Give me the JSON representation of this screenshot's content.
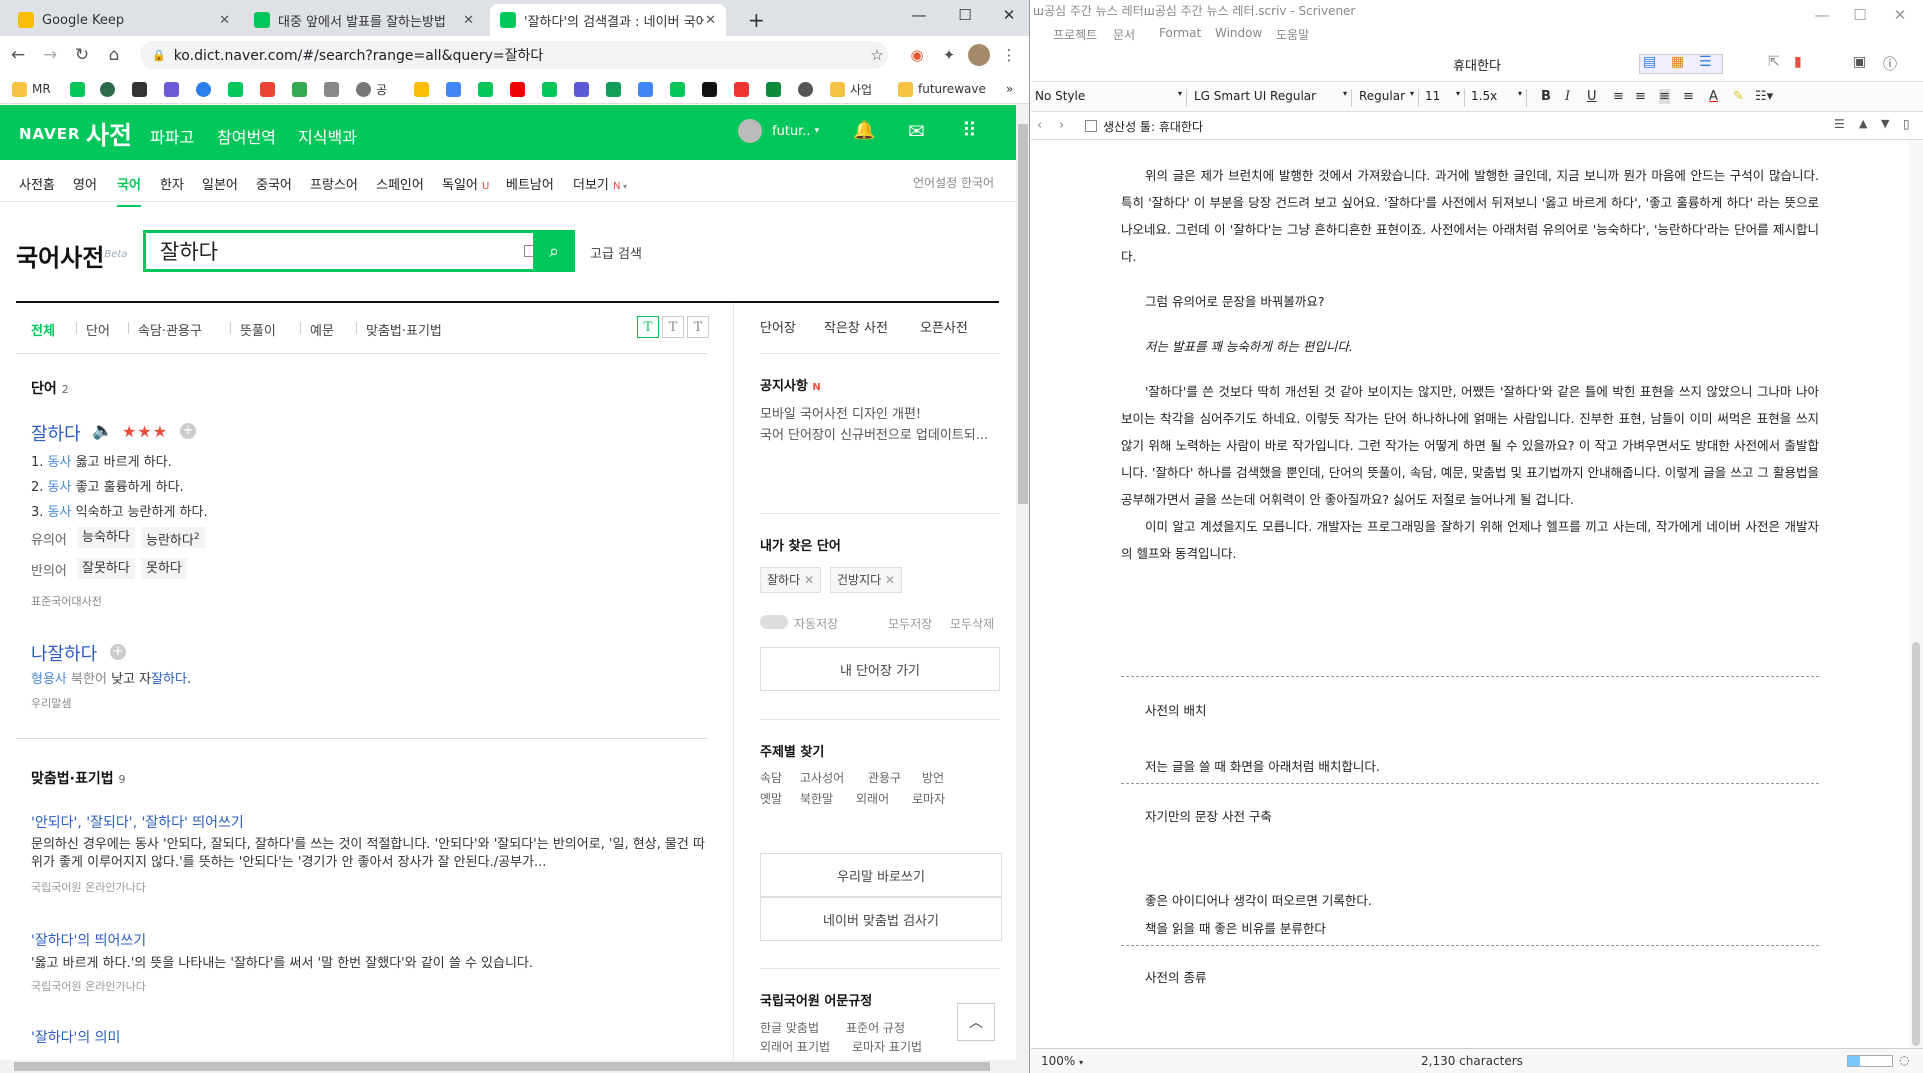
{
  "browser": {
    "tabs": [
      {
        "title": "Google Keep",
        "icon": "keep-icon",
        "color": "#fbbc04"
      },
      {
        "title": "대중 앞에서 발표를 잘하는방법",
        "icon": "blog-icon",
        "color": "#03c75a"
      },
      {
        "title": "'잘하다'의 검색결과 : 네이버 국어",
        "icon": "naver-dict-icon",
        "color": "#03c75a"
      }
    ],
    "new_tab": "+",
    "url": "ko.dict.naver.com/#/search?range=all&query=잘하다",
    "bookmarks": [
      "MR",
      "공",
      "사업",
      "futurewave"
    ],
    "more_bookmarks": "»"
  },
  "naver": {
    "logo": "NAVER",
    "service": "사전",
    "nav_links": [
      "파파고",
      "참여번역",
      "지식백과"
    ],
    "user": "futur..",
    "lang_nav": [
      "사전홈",
      "영어",
      "국어",
      "한자",
      "일본어",
      "중국어",
      "프랑스어",
      "스페인어",
      "독일어",
      "베트남어",
      "더보기"
    ],
    "lang_nav_badges": {
      "u": "U",
      "n": "N"
    },
    "lang_setting": "언어설정 한국어",
    "dict_title": "국어사전",
    "beta": "Beta",
    "query": "잘하다",
    "advanced_search": "고급 검색",
    "filter_tabs": [
      "전체",
      "단어",
      "속담·관용구",
      "뜻풀이",
      "예문",
      "맞춤법·표기법"
    ],
    "text_size": [
      "T",
      "T",
      "T"
    ],
    "word_section": {
      "title": "단어",
      "count": "2"
    },
    "entry1": {
      "word": "잘하다",
      "stars": "★★★",
      "meanings": [
        {
          "num": "1.",
          "pos": "동사",
          "text": "옳고 바르게 하다."
        },
        {
          "num": "2.",
          "pos": "동사",
          "text": "좋고 훌륭하게 하다."
        },
        {
          "num": "3.",
          "pos": "동사",
          "text": "익숙하고 능란하게 하다."
        }
      ],
      "synonym_label": "유의어",
      "synonyms": [
        "능숙하다",
        "능란하다"
      ],
      "synonym_sup": "2",
      "antonym_label": "반의어",
      "antonyms": [
        "잘못하다",
        "못하다"
      ],
      "source": "표준국어대사전"
    },
    "entry2": {
      "word": "나잘하다",
      "pos": "형용사",
      "region": "북한어",
      "def_pre": "낮고 자",
      "def_hl": "잘하다",
      "def_post": ".",
      "source": "우리말샘"
    },
    "spelling_section": {
      "title": "맞춤법·표기법",
      "count": "9"
    },
    "results": [
      {
        "title": "'안되다', '잘되다', '잘하다' 띄어쓰기",
        "body": "문의하신 경우에는 동사 '안되다, 잘되다, 잘하다'를 쓰는 것이 적절합니다. '안되다'와 '잘되다'는 반의어로, '일, 현상, 물건 따위가 좋게 이루어지지 않다.'를 뜻하는 '안되다'는 '경기가 안 좋아서 장사가 잘 안된다./공부가...",
        "source": "국립국어원 온라인가나다"
      },
      {
        "title": "'잘하다'의 띄어쓰기",
        "body": "'옳고 바르게 하다.'의 뜻을 나타내는 '잘하다'를 써서 '말 한번 잘했다'와 같이 쓸 수 있습니다.",
        "source": "국립국어원 온라인가나다"
      },
      {
        "title": "'잘하다'의 의미",
        "body": "",
        "source": ""
      }
    ],
    "right": {
      "tabs": [
        "단어장",
        "작은창 사전",
        "오픈사전"
      ],
      "notice_title": "공지사항",
      "notice_badge": "N",
      "notices": [
        "모바일 국어사전 디자인 개편!",
        "국어 단어장이 신규버전으로 업데이트되..."
      ],
      "found_title": "내가 찾은 단어",
      "found_words": [
        "잘하다",
        "건방지다"
      ],
      "autosave": "자동저장",
      "save_all": "모두저장",
      "delete_all": "모두삭제",
      "wordbook_btn": "내 단어장 가기",
      "topic_title": "주제별 찾기",
      "topics_row1": [
        "속담",
        "고사성어",
        "관용구",
        "방언"
      ],
      "topics_row2": [
        "옛말",
        "북한말",
        "외래어",
        "로마자"
      ],
      "btn_correct": "우리말 바로쓰기",
      "btn_spell": "네이버 맞춤법 검사기",
      "rules_title": "국립국어원 어문규정",
      "rules_row1": [
        "한글 맞춤법",
        "표준어 규정"
      ],
      "rules_row2": [
        "외래어 표기법",
        "로마자 표기법"
      ]
    }
  },
  "scrivener": {
    "window_title": "ш공심 주간 뉴스 레터ш공심 주간 뉴스 레터.scriv - Scrivener",
    "menu": [
      "프로젝트",
      "문서",
      "Format",
      "Window",
      "도움말"
    ],
    "doc_title": "휴대한다",
    "style": "No Style",
    "font": "LG Smart UI Regular",
    "weight": "Regular",
    "size": "11",
    "spacing": "1.5x",
    "header_title": "생산성 툴: 휴대한다",
    "paragraphs": [
      "위의 글은 제가 브런치에 발행한 것에서 가져왔습니다. 과거에 발행한 글인데, 지금 보니까 뭔가 마음에 안드는 구석이 많습니다. 특히 '잘하다' 이 부분을 당장 건드려 보고 싶어요. '잘하다'를 사전에서 뒤져보니 '옳고 바르게 하다', '좋고 훌륭하게 하다' 라는 뜻으로 나오네요. 그런데 이 '잘하다'는 그냥 흔하디흔한 표현이죠. 사전에서는 아래처럼 유의어로 '능숙하다', '능란하다'라는 단어를 제시합니다.",
      "그럼 유의어로 문장을 바꿔볼까요?",
      "저는 발표를 꽤 능숙하게 하는 편입니다.",
      "'잘하다'를 쓴 것보다 딱히 개선된 것 같아 보이지는 않지만, 어쨌든 '잘하다'와 같은 틀에 박힌 표현을 쓰지 않았으니 그나마 나아보이는 착각을 심어주기도 하네요. 이렇듯 작가는 단어 하나하나에 얽매는 사람입니다. 진부한 표현, 남들이 이미 써먹은 표현을 쓰지 않기 위해 노력하는 사람이 바로 작가입니다. 그런 작가는 어떻게 하면 될 수 있을까요? 이 작고 가벼우면서도 방대한 사전에서 출발합니다. '잘하다' 하나를 검색했을 뿐인데, 단어의 뜻풀이, 속담, 예문, 맞춤법 및 표기법까지 안내해줍니다. 이렇게 글을 쓰고 그 활용법을 공부해가면서 글을 쓰는데 어휘력이 안 좋아질까요? 싫어도 저절로 늘어나게 될 겁니다.",
      "이미 알고 계셨을지도 모릅니다. 개발자는 프로그래밍을 잘하기 위해 언제나 헬프를 끼고 사는데, 작가에게 네이버 사전은 개발자의 헬프와 동격입니다."
    ],
    "outline": [
      "사전의 배치",
      "저는 글을 쓸 때 화면을 아래처럼 배치합니다.",
      "자기만의 문장 사전 구축",
      "좋은 아이디어나 생각이 떠오르면 기록한다.",
      "책을 읽을 때 좋은 비유를 분류한다",
      "사전의 종류"
    ],
    "zoom": "100%",
    "char_count": "2,130 characters"
  }
}
